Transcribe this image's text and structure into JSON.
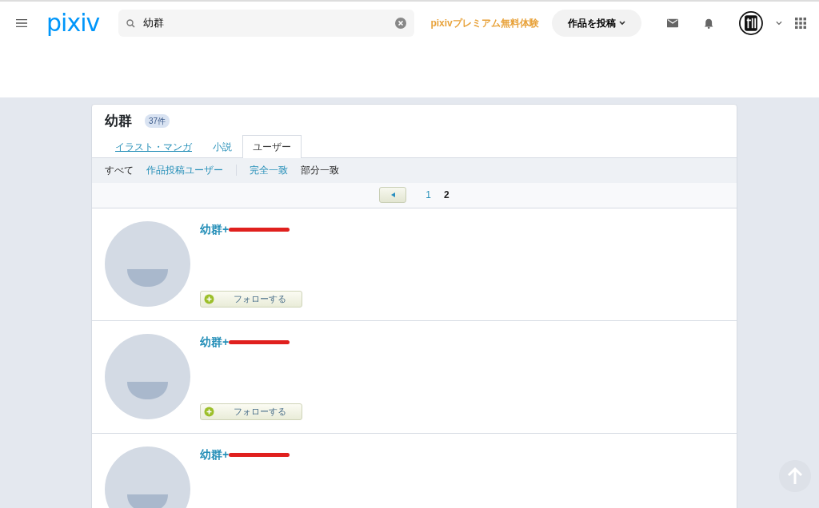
{
  "header": {
    "logo": "pixiv",
    "search": {
      "value": "幼群"
    },
    "premium_link": "pixivプレミアム無料体験",
    "post_button": "作品を投稿"
  },
  "result": {
    "title": "幼群",
    "count": "37件",
    "tabs": [
      {
        "label": "イラスト・マンガ",
        "selected": false
      },
      {
        "label": "小説",
        "selected": false
      },
      {
        "label": "ユーザー",
        "selected": true
      }
    ],
    "filter_groups": [
      [
        {
          "label": "すべて",
          "selected": true
        },
        {
          "label": "作品投稿ユーザー",
          "selected": false
        }
      ],
      [
        {
          "label": "完全一致",
          "selected": false
        },
        {
          "label": "部分一致",
          "selected": true
        }
      ]
    ],
    "pagination": {
      "pages": [
        {
          "label": "1",
          "selected": false
        },
        {
          "label": "2",
          "selected": true
        }
      ]
    },
    "users": [
      {
        "name": "幼群+",
        "redacted": true,
        "follow_button": "フォローする"
      },
      {
        "name": "幼群+",
        "redacted": true,
        "follow_button": "フォローする"
      },
      {
        "name": "幼群+",
        "redacted": true
      }
    ]
  }
}
